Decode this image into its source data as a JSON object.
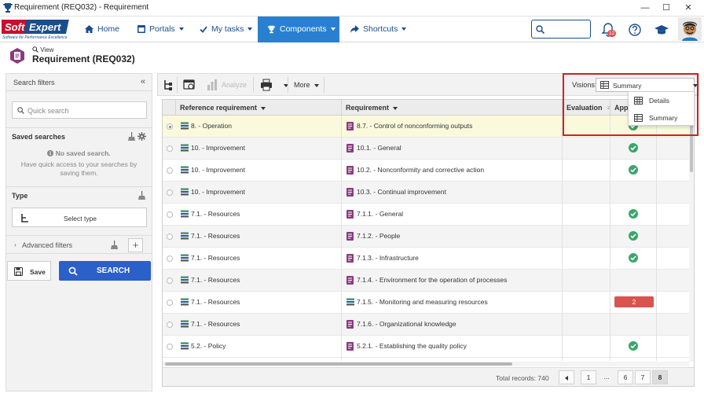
{
  "window": {
    "title": "Requirement (REQ032) - Requirement",
    "controls": {
      "minimize": "—",
      "maximize": "☐",
      "close": "✕"
    }
  },
  "nav": {
    "logo": {
      "brand_soft": "Soft",
      "brand_expert": "Expert",
      "tagline": "Software for Performance Excellence"
    },
    "items": [
      {
        "label": "Home",
        "icon": "home-icon",
        "dropdown": false
      },
      {
        "label": "Portals",
        "icon": "portals-icon",
        "dropdown": true
      },
      {
        "label": "My tasks",
        "icon": "checkmark-icon",
        "dropdown": true
      },
      {
        "label": "Components",
        "icon": "trophy-icon",
        "dropdown": true,
        "active": true
      },
      {
        "label": "Shortcuts",
        "icon": "share-icon",
        "dropdown": true
      }
    ],
    "search_placeholder": "",
    "notifications_count": "12",
    "colors": {
      "primary": "#1a4e8c",
      "active_bg": "#2a80d0"
    }
  },
  "page": {
    "view_label": "View",
    "title": "Requirement (REQ032)"
  },
  "left_panel": {
    "title": "Search filters",
    "quick_search_placeholder": "Quick search",
    "saved_searches_title": "Saved searches",
    "no_saved_title": "No saved search.",
    "no_saved_hint": "Have quick access to your searches by saving them.",
    "type_title": "Type",
    "select_type_label": "Select type",
    "advanced_filters_label": "Advanced filters",
    "save_label": "Save",
    "search_label": "SEARCH"
  },
  "toolbar": {
    "analyze_label": "Analyze",
    "more_label": "More",
    "visions_label": "Visions:",
    "visions_value": "Summary"
  },
  "visions_menu": {
    "options": [
      "Details",
      "Summary"
    ]
  },
  "grid": {
    "columns": [
      "Reference requirement",
      "Requirement",
      "Evaluation",
      "Appl"
    ],
    "rows": [
      {
        "ref": "8. - Operation",
        "req": "8.7. - Control of nonconforming outputs",
        "req_icon": "doc",
        "status": "check",
        "selected": true
      },
      {
        "ref": "10. - Improvement",
        "req": "10.1. - General",
        "req_icon": "doc",
        "status": "check"
      },
      {
        "ref": "10. - Improvement",
        "req": "10.2. - Nonconformity and corrective action",
        "req_icon": "doc",
        "status": "check"
      },
      {
        "ref": "10. - Improvement",
        "req": "10.3. - Continual improvement",
        "req_icon": "doc",
        "status": "none"
      },
      {
        "ref": "7.1. - Resources",
        "req": "7.1.1. - General",
        "req_icon": "doc",
        "status": "check"
      },
      {
        "ref": "7.1. - Resources",
        "req": "7.1.2. - People",
        "req_icon": "doc",
        "status": "check"
      },
      {
        "ref": "7.1. - Resources",
        "req": "7.1.3. - Infrastructure",
        "req_icon": "doc",
        "status": "check"
      },
      {
        "ref": "7.1. - Resources",
        "req": "7.1.4. - Environment for the operation of processes",
        "req_icon": "doc",
        "status": "none"
      },
      {
        "ref": "7.1. - Resources",
        "req": "7.1.5. - Monitoring and measuring resources",
        "req_icon": "stack",
        "status": "count",
        "count": "2"
      },
      {
        "ref": "7.1. - Resources",
        "req": "7.1.6. - Organizational knowledge",
        "req_icon": "doc",
        "status": "none"
      },
      {
        "ref": "5.2. - Policy",
        "req": "5.2.1. - Establishing the quality policy",
        "req_icon": "doc",
        "status": "check"
      }
    ],
    "total_records": "Total records: 740",
    "pages": [
      "1",
      "...",
      "6",
      "7",
      "8"
    ],
    "current_page": "8"
  }
}
